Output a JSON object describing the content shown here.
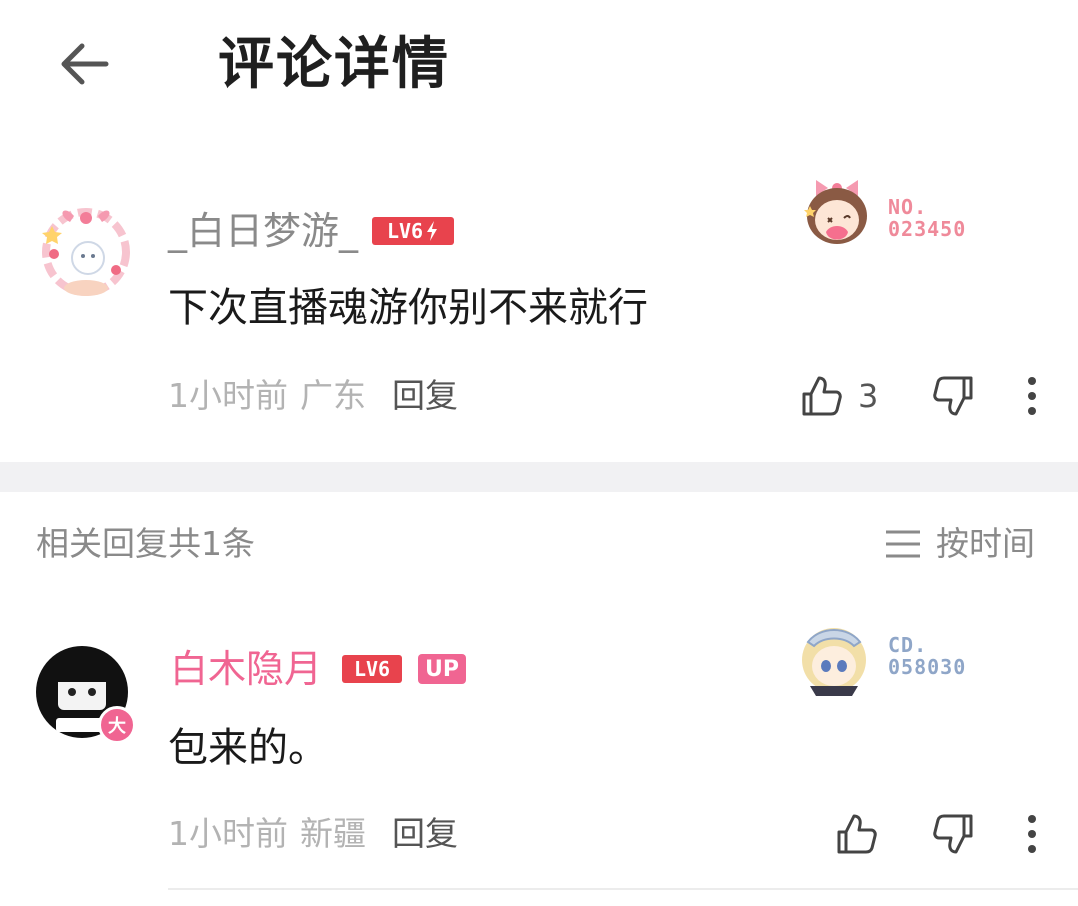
{
  "header": {
    "title": "评论详情"
  },
  "comment": {
    "username": "_白日梦游_",
    "level": "LV6",
    "badge_no": "NO.",
    "badge_number": "023450",
    "text": "下次直播魂游你别不来就行",
    "time": "1小时前",
    "location": "广东",
    "reply_label": "回复",
    "like_count": "3"
  },
  "replies_section": {
    "label": "相关回复共1条",
    "sort_label": "按时间"
  },
  "reply": {
    "username": "白木隐月",
    "level": "LV6",
    "up_badge": "UP",
    "avatar_tag": "大",
    "badge_prefix": "CD.",
    "badge_number": "058030",
    "text": "包来的。",
    "time": "1小时前",
    "location": "新疆",
    "reply_label": "回复"
  },
  "colors": {
    "level_badge": "#e8434d",
    "reply_username": "#f06592",
    "badge_pink": "#ef8a9a",
    "badge_blue": "#8fa6c8"
  }
}
